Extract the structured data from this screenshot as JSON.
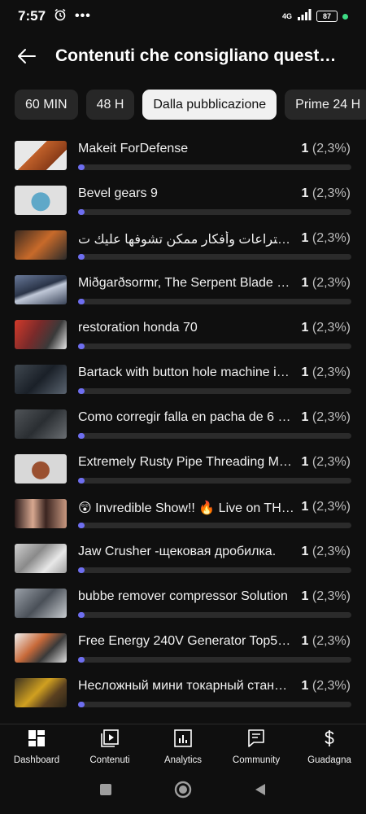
{
  "status": {
    "time": "7:57",
    "network": "4G",
    "battery": "87",
    "accent_dot_color": "#3ddc84"
  },
  "header": {
    "title": "Contenuti che consigliano quest…",
    "back_icon": "arrow-left-icon"
  },
  "filters": {
    "chips": [
      {
        "label": "60 MIN",
        "selected": false
      },
      {
        "label": "48 H",
        "selected": false
      },
      {
        "label": "Dalla pubblicazione",
        "selected": true
      },
      {
        "label": "Prime 24 H",
        "selected": false
      }
    ]
  },
  "videos": [
    {
      "title": "Makeit ForDefense",
      "count": "1",
      "percent": "(2,3%)",
      "fraction": 0.023
    },
    {
      "title": "Bevel gears 9",
      "count": "1",
      "percent": "(2,3%)",
      "fraction": 0.023
    },
    {
      "title": "أقوى اختراعات وأفكار ممكن تشوفها عليك ت…",
      "count": "1",
      "percent": "(2,3%)",
      "fraction": 0.023
    },
    {
      "title": "Miðgarðsormr, The Serpent Blade V…",
      "count": "1",
      "percent": "(2,3%)",
      "fraction": 0.023
    },
    {
      "title": "restoration honda 70",
      "count": "1",
      "percent": "(2,3%)",
      "fraction": 0.023
    },
    {
      "title": "Bartack with button hole machine i…",
      "count": "1",
      "percent": "(2,3%)",
      "fraction": 0.023
    },
    {
      "title": "Como corregir falla en pacha de 6 v…",
      "count": "1",
      "percent": "(2,3%)",
      "fraction": 0.023
    },
    {
      "title": "Extremely Rusty Pipe Threading Ma…",
      "count": "1",
      "percent": "(2,3%)",
      "fraction": 0.023
    },
    {
      "title": "😲 Invredible Show!! 🔥 Live on TH…",
      "count": "1",
      "percent": "(2,3%)",
      "fraction": 0.023
    },
    {
      "title": "Jaw Crusher -щековая дробилка.",
      "count": "1",
      "percent": "(2,3%)",
      "fraction": 0.023
    },
    {
      "title": "bubbe remover compressor Solution",
      "count": "1",
      "percent": "(2,3%)",
      "fraction": 0.023
    },
    {
      "title": "Free Energy 240V Generator Top5…",
      "count": "1",
      "percent": "(2,3%)",
      "fraction": 0.023
    },
    {
      "title": "Несложный мини токарный стан…",
      "count": "1",
      "percent": "(2,3%)",
      "fraction": 0.023
    }
  ],
  "bottom_nav": {
    "items": [
      {
        "label": "Dashboard",
        "icon": "dashboard-icon"
      },
      {
        "label": "Contenuti",
        "icon": "content-icon"
      },
      {
        "label": "Analytics",
        "icon": "analytics-icon"
      },
      {
        "label": "Community",
        "icon": "community-icon"
      },
      {
        "label": "Guadagna",
        "icon": "dollar-icon"
      }
    ]
  },
  "system_nav": {
    "buttons": [
      "recents-icon",
      "home-icon",
      "back-icon"
    ]
  },
  "colors": {
    "background": "#0f0f0f",
    "chip": "#272727",
    "chip_selected": "#f1f1f1",
    "bar_track": "#2b2b2b",
    "bar_fill": "#6e6ef0"
  }
}
